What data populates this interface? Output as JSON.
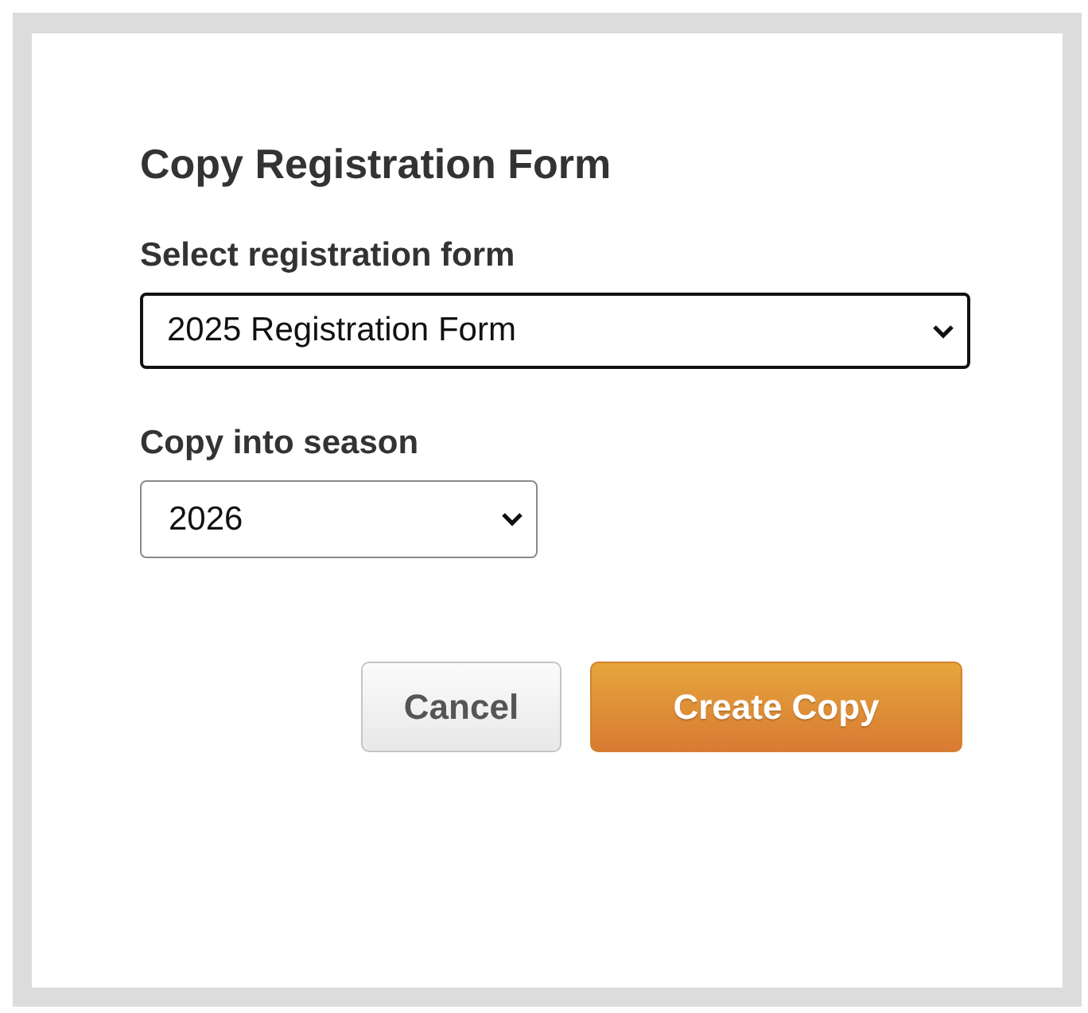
{
  "dialog": {
    "title": "Copy Registration Form"
  },
  "fields": [
    {
      "label": "Select registration form",
      "value": "2025 Registration Form",
      "focused": true,
      "kind": "wide"
    },
    {
      "label": "Copy into season",
      "value": "2026",
      "focused": false,
      "kind": "narrow"
    }
  ],
  "buttons": [
    {
      "label": "Cancel",
      "kind": "secondary"
    },
    {
      "label": "Create Copy",
      "kind": "primary"
    }
  ]
}
